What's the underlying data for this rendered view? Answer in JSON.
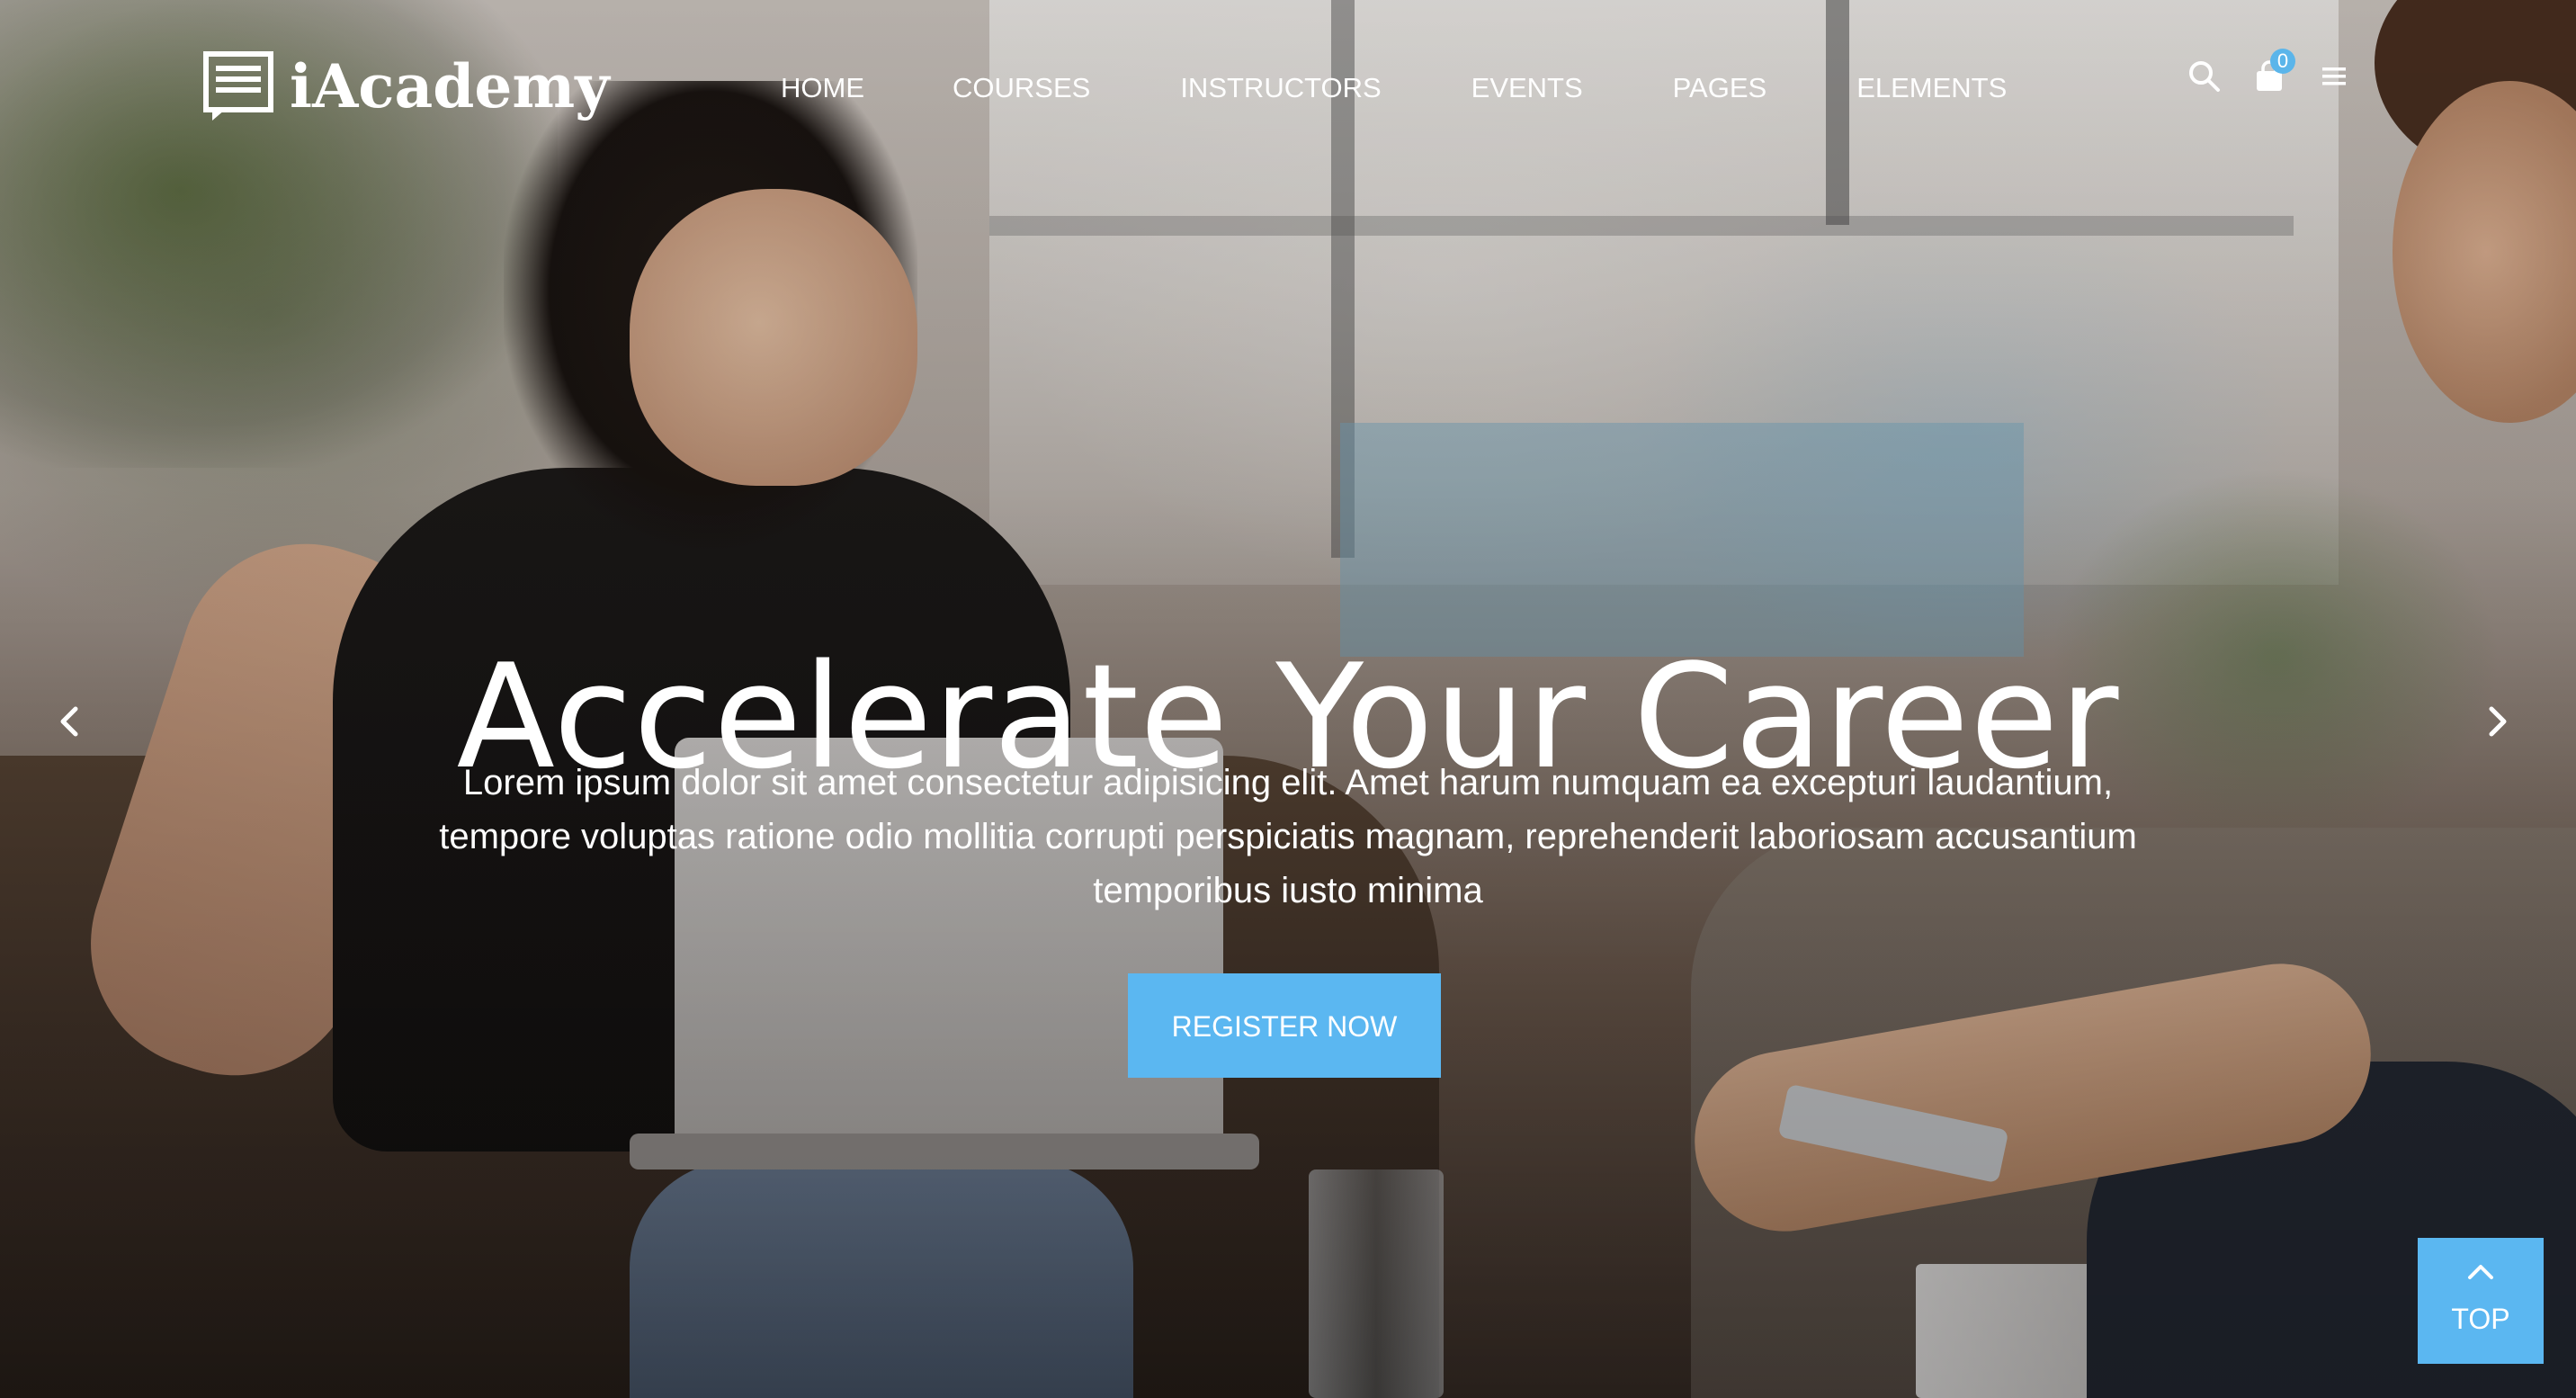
{
  "brand": {
    "name": "iAcademy",
    "icon": "logo-document-icon"
  },
  "nav": {
    "items": [
      {
        "label": "HOME"
      },
      {
        "label": "COURSES"
      },
      {
        "label": "INSTRUCTORS"
      },
      {
        "label": "EVENTS"
      },
      {
        "label": "PAGES"
      },
      {
        "label": "ELEMENTS"
      }
    ]
  },
  "header_icons": {
    "search": "search-icon",
    "cart": "shopping-bag-icon",
    "cart_count": "0",
    "menu": "hamburger-menu-icon"
  },
  "hero": {
    "title": "Accelerate Your Career",
    "description_line1": "Lorem ipsum dolor sit amet consectetur adipisicing elit. Amet harum numquam ea excepturi laudantium,",
    "description_line2": "tempore voluptas ratione odio mollitia corrupti perspiciatis magnam, reprehenderit laboriosam accusantium",
    "description_line3": "temporibus iusto minima",
    "cta_label": "REGISTER NOW",
    "prev_icon": "chevron-left-icon",
    "next_icon": "chevron-right-icon"
  },
  "back_to_top": {
    "label": "TOP",
    "icon": "chevron-up-icon"
  },
  "colors": {
    "accent": "#5bb7f1",
    "badge": "#5bb5ea",
    "text": "#ffffff"
  }
}
